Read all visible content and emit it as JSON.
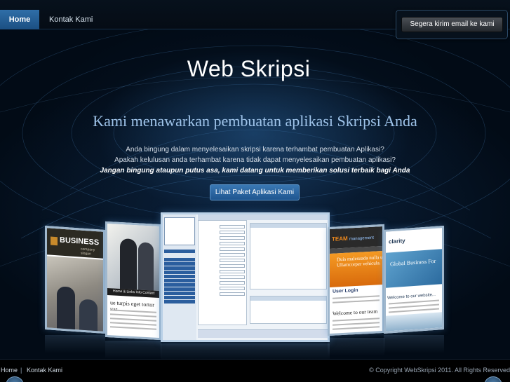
{
  "nav": {
    "items": [
      {
        "label": "Home",
        "active": true
      },
      {
        "label": "Kontak Kami",
        "active": false
      }
    ]
  },
  "email_button": {
    "label": "Segera kirim email ke kami"
  },
  "hero": {
    "title": "Web Skripsi",
    "tagline": "Kami menawarkan pembuatan aplikasi Skripsi Anda",
    "desc_lines": [
      "Anda bingung dalam menyelesaikan skripsi karena terhambat pembuatan Aplikasi?",
      "Apakah kelulusan anda terhambat karena tidak dapat menyelesaikan pembuatan aplikasi?",
      "Jangan bingung ataupun putus asa, kami datang untuk memberikan solusi terbaik bagi Anda"
    ],
    "cta_label": "Lihat Paket Aplikasi Kami"
  },
  "showcase": {
    "shot1": {
      "logo": "BUSINESS",
      "subtitle": "company slogan"
    },
    "shot2": {
      "nav_text": "Home  &  Links   Info   Contact",
      "heading": "ue turpis eget tortor var"
    },
    "shot4": {
      "logo_prefix": "TEAM",
      "logo_suffix": "management",
      "banner_text": "Duis malesuada nulla ut Ullamcorper vehicula.",
      "login": "User Login",
      "welcome": "Welcome to our team"
    },
    "shot5": {
      "logo": "clarity",
      "banner_text": "Global Business For",
      "welcome": "Welcome to our website..."
    }
  },
  "footer": {
    "links": [
      "Home",
      "Kontak Kami"
    ],
    "separator": "|",
    "copyright": "© Copyright WebSkripsi 2011. All Rights Reserved"
  },
  "colors": {
    "accent": "#2f6ea8",
    "background": "#020b16",
    "tagline": "#9fc4ea"
  }
}
